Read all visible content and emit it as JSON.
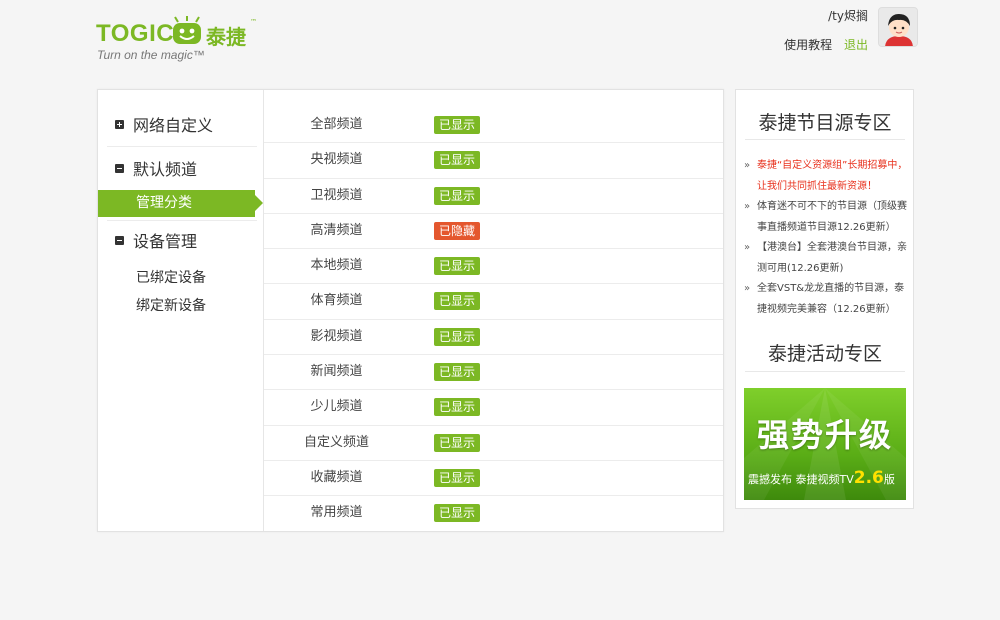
{
  "brand": {
    "wordmark": "TOGIC",
    "name_cn": "泰捷",
    "trademark": "™",
    "tagline": "Turn on the magic™",
    "accent_color": "#7cb824"
  },
  "user": {
    "name": "/ty烬搁",
    "tutorial_label": "使用教程",
    "logout_label": "退出",
    "avatar_icon": "user-avatar-icon"
  },
  "sidebar": {
    "groups": [
      {
        "label": "网络自定义",
        "icon": "plus-square-icon"
      },
      {
        "label": "默认频道",
        "icon": "minus-square-icon"
      },
      {
        "label": "设备管理",
        "icon": "minus-square-icon"
      }
    ],
    "active_item": "管理分类",
    "device_items": [
      "已绑定设备",
      "绑定新设备"
    ]
  },
  "channels": [
    {
      "name": "全部频道",
      "status": "已显示"
    },
    {
      "name": "央视频道",
      "status": "已显示"
    },
    {
      "name": "卫视频道",
      "status": "已显示"
    },
    {
      "name": "高清频道",
      "status": "已隐藏"
    },
    {
      "name": "本地频道",
      "status": "已显示"
    },
    {
      "name": "体育频道",
      "status": "已显示"
    },
    {
      "name": "影视频道",
      "status": "已显示"
    },
    {
      "name": "新闻频道",
      "status": "已显示"
    },
    {
      "name": "少儿频道",
      "status": "已显示"
    },
    {
      "name": "自定义频道",
      "status": "已显示"
    },
    {
      "name": "收藏频道",
      "status": "已显示"
    },
    {
      "name": "常用频道",
      "status": "已显示"
    }
  ],
  "status_colors": {
    "shown": "#7cb824",
    "hidden": "#e4572e"
  },
  "right_panel": {
    "source_title": "泰捷节目源专区",
    "news": [
      "泰捷“自定义资源组”长期招募中，让我们共同抓住最新资源！",
      "体育迷不可不下的节目源（顶级赛事直播频道节目源12.26更新）",
      "【港澳台】全套港澳台节目源，亲测可用(12.26更新)",
      "全套VST&龙龙直播的节目源，泰捷视频完美兼容（12.26更新）"
    ],
    "activity_title": "泰捷活动专区",
    "promo_headline": "强势升级",
    "promo_sub": "震撼发布 泰捷视频TV",
    "promo_version": "2.6",
    "promo_suffix": "版"
  }
}
